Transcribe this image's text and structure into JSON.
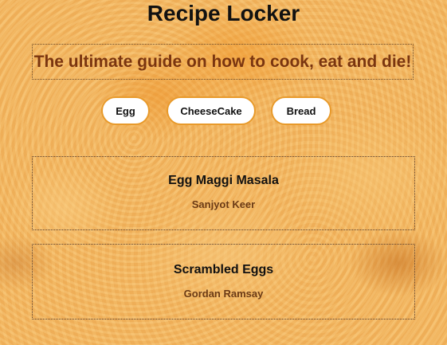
{
  "header": {
    "title": "Recipe Locker",
    "tagline": "The ultimate guide on how to cook, eat and die!"
  },
  "filters": [
    {
      "label": "Egg"
    },
    {
      "label": "CheeseCake"
    },
    {
      "label": "Bread"
    }
  ],
  "recipes": [
    {
      "title": "Egg Maggi Masala",
      "author": "Sanjyot Keer"
    },
    {
      "title": "Scrambled Eggs",
      "author": "Gordan Ramsay"
    }
  ],
  "colors": {
    "background": "#f2b660",
    "tagline_text": "#7a3510",
    "button_border": "#e89a2b",
    "author_text": "#6b3a15"
  }
}
